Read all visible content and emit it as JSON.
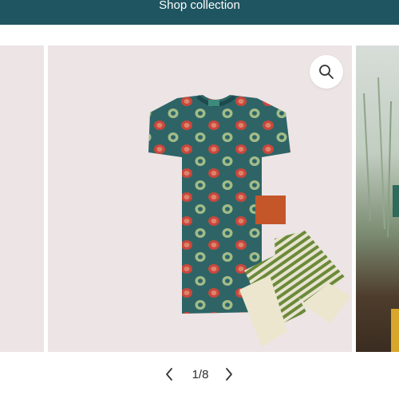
{
  "header": {
    "shop_label": "Shop collection"
  },
  "gallery": {
    "current": "1",
    "total": "8",
    "counter_text": "1/8",
    "zoom_icon": "search-icon",
    "prev_icon": "chevron-left-icon",
    "next_icon": "chevron-right-icon"
  },
  "colors": {
    "header_bg": "#1f5560",
    "slide_bg": "#ece4e5",
    "tshirt": "#2e6466",
    "pocket": "#c4562a",
    "stripe_green": "#6b8a3a",
    "cuff": "#ece6cf"
  }
}
